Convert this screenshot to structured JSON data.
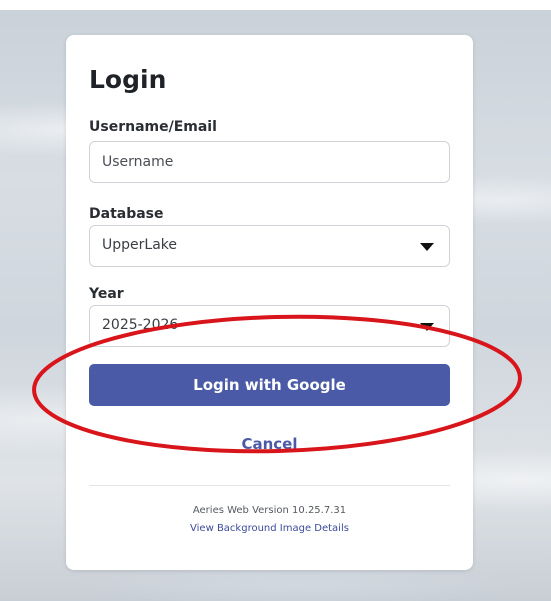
{
  "login": {
    "title": "Login",
    "username": {
      "label": "Username/Email",
      "placeholder": "Username"
    },
    "database": {
      "label": "Database",
      "selected": "UpperLake"
    },
    "year": {
      "label": "Year",
      "selected": "2025-2026"
    },
    "login_button": "Login with Google",
    "cancel": "Cancel",
    "version": "Aeries Web Version 10.25.7.31",
    "background_details": "View Background Image Details"
  },
  "colors": {
    "accent": "#4a5aa6",
    "annotation": "#d8151b"
  }
}
